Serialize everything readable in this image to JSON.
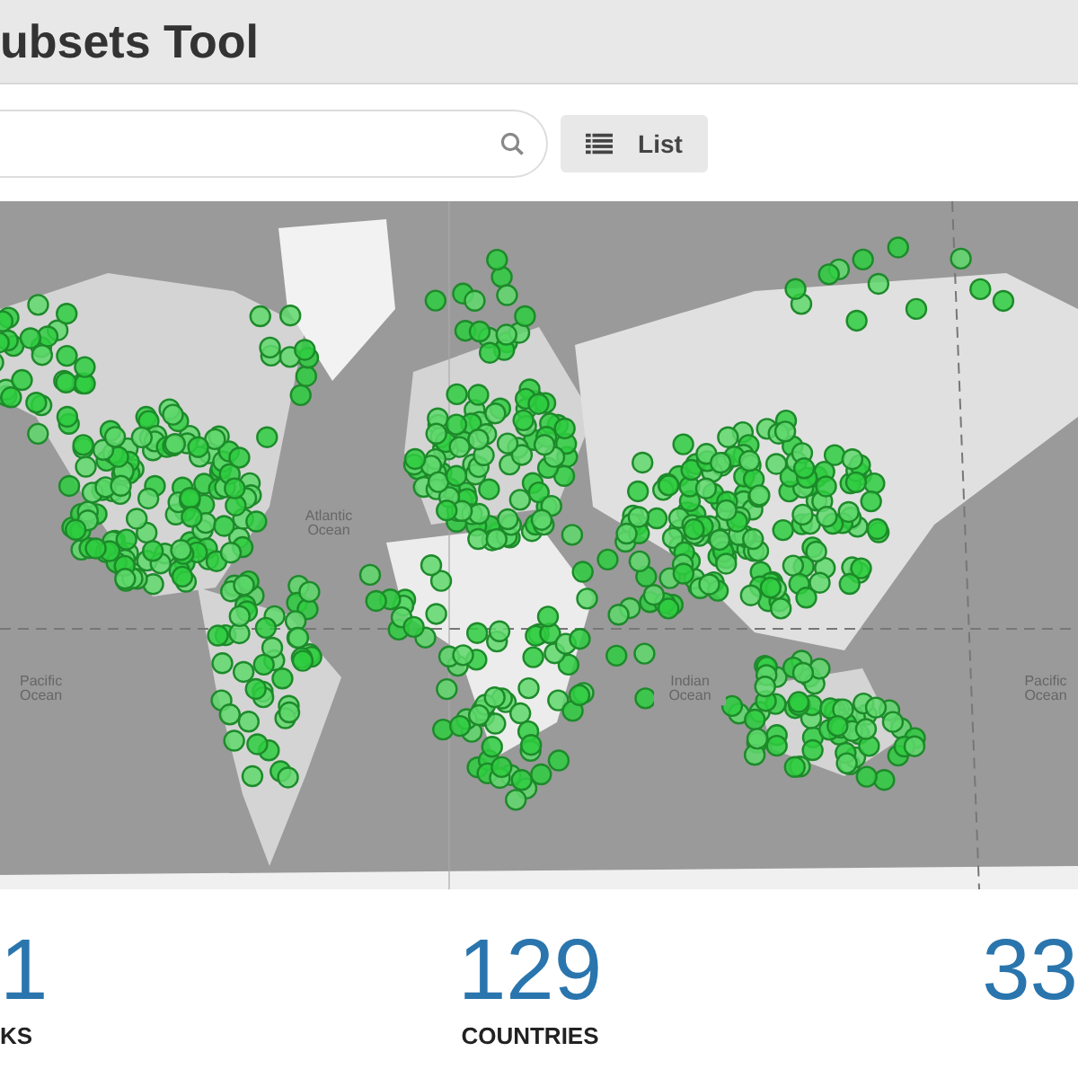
{
  "header": {
    "title": "ubsets Tool"
  },
  "toolbar": {
    "view_button": {
      "label": "List"
    }
  },
  "map": {
    "labels": [
      {
        "text": "Atlantic Ocean"
      },
      {
        "text": "Pacific Ocean"
      },
      {
        "text": "Indian Ocean"
      },
      {
        "text": "Pacific Ocean"
      }
    ]
  },
  "stats": [
    {
      "value": "1",
      "label": "KS"
    },
    {
      "value": "129",
      "label": "COUNTRIES"
    },
    {
      "value": "33"
    }
  ]
}
